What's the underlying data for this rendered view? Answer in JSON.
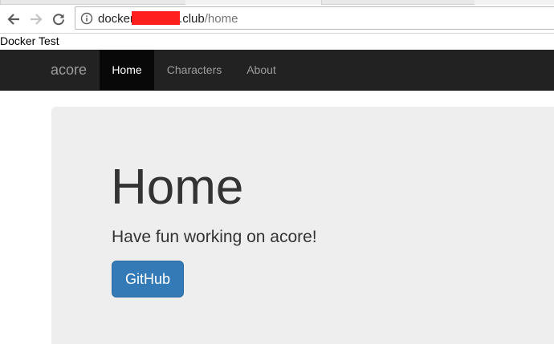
{
  "browser": {
    "url_prefix": "docker",
    "url_domain_suffix": ".club",
    "url_path": "/home"
  },
  "page": {
    "caption": "Docker Test"
  },
  "navbar": {
    "brand": "acore",
    "links": [
      {
        "label": "Home",
        "active": true
      },
      {
        "label": "Characters",
        "active": false
      },
      {
        "label": "About",
        "active": false
      }
    ]
  },
  "jumbotron": {
    "title": "Home",
    "lead": "Have fun working on acore!",
    "button_label": "GitHub"
  },
  "colors": {
    "navbar_bg": "#222222",
    "active_link_bg": "#080808",
    "jumbotron_bg": "#eeeeee",
    "primary_button": "#337ab7",
    "redaction": "#ff1f1f"
  },
  "icons": [
    "back-arrow-icon",
    "forward-arrow-icon",
    "reload-icon",
    "info-icon"
  ]
}
